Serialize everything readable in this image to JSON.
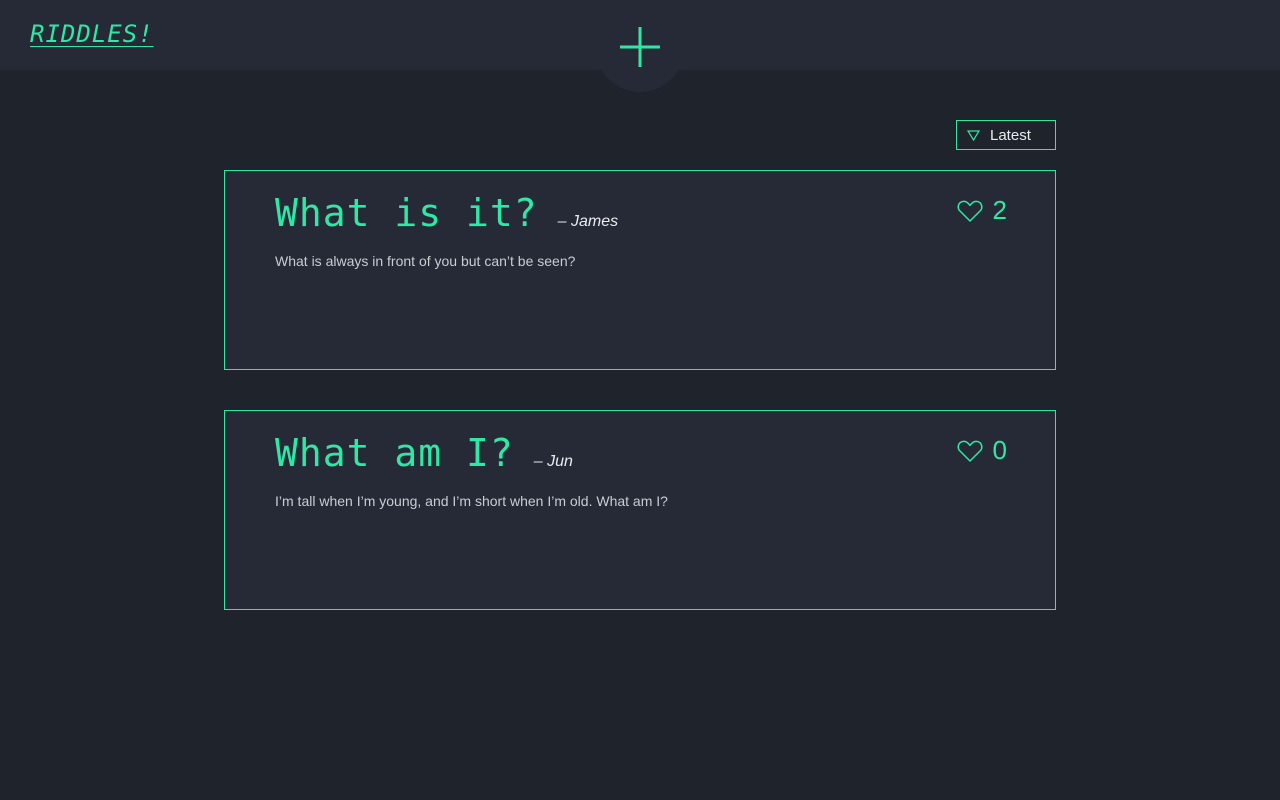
{
  "header": {
    "logo": "RIDDLES!",
    "add_icon": "plus-icon"
  },
  "sort": {
    "label": "Latest",
    "icon": "triangle-down-icon"
  },
  "riddles": [
    {
      "title": "What is it?",
      "author": "– James",
      "body": "What is always in front of you but can’t be seen?",
      "likes": "2",
      "like_icon": "heart-outline-icon"
    },
    {
      "title": "What am I?",
      "author": "– Jun",
      "body": "I’m tall when I’m young, and I’m short when I’m old. What am I?",
      "likes": "0",
      "like_icon": "heart-outline-icon"
    }
  ],
  "colors": {
    "accent": "#2ee8a5",
    "background": "#1f232b",
    "surface": "#252a36",
    "text": "#e8ebef"
  }
}
